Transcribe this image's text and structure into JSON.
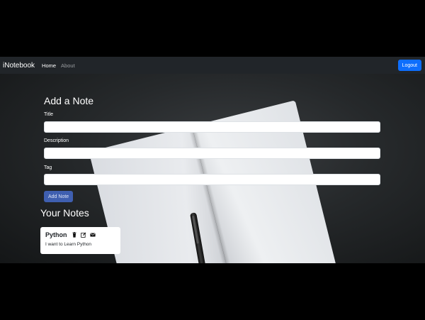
{
  "navbar": {
    "brand": "iNotebook",
    "links": [
      {
        "label": "Home",
        "active": true
      },
      {
        "label": "About",
        "active": false
      }
    ],
    "logout_label": "Logout"
  },
  "add_note": {
    "heading": "Add a Note",
    "title_label": "Title",
    "title_value": "",
    "description_label": "Description",
    "description_value": "",
    "tag_label": "Tag",
    "tag_value": "",
    "submit_label": "Add Note"
  },
  "notes": {
    "heading": "Your Notes",
    "items": [
      {
        "title": "Python",
        "description": "I want to Learn Python",
        "icons": [
          "trash-icon",
          "edit-icon",
          "envelope-icon"
        ]
      }
    ]
  },
  "colors": {
    "navbar_bg": "#212529",
    "primary": "#0d6efd",
    "add_button": "#3f5fb0",
    "frame": "#000000"
  }
}
